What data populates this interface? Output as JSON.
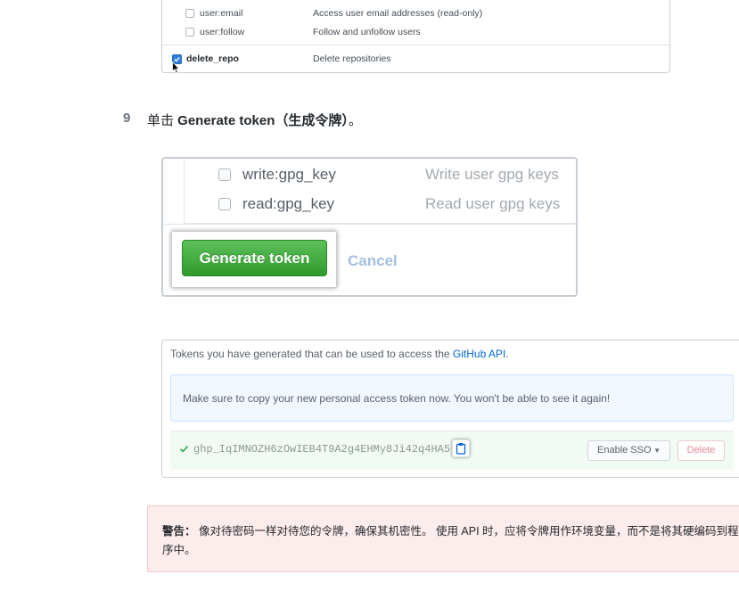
{
  "scopes": {
    "rows": [
      {
        "name": "user:email",
        "description": "Access user email addresses (read-only)",
        "checked": false
      },
      {
        "name": "user:follow",
        "description": "Follow and unfollow users",
        "checked": false
      }
    ],
    "delete_repo": {
      "name": "delete_repo",
      "description": "Delete repositories",
      "checked": true
    }
  },
  "step9": {
    "number": "9",
    "prefix": "单击 ",
    "button_ref": "Generate token（生成令牌）",
    "suffix": "。"
  },
  "generate_panel": {
    "gpg_rows": [
      {
        "name": "write:gpg_key",
        "description": "Write user gpg keys"
      },
      {
        "name": "read:gpg_key",
        "description": "Read user gpg keys"
      }
    ],
    "generate_label": "Generate token",
    "cancel_label": "Cancel"
  },
  "token_panel": {
    "intro_text": "Tokens you have generated that can be used to access the ",
    "intro_link": "GitHub API",
    "intro_end": ".",
    "notice": "Make sure to copy your new personal access token now. You won't be able to see it again!",
    "token": "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",
    "sso_label": "Enable SSO",
    "delete_label": "Delete"
  },
  "warning": {
    "label": "警告：",
    "text": " 像对待密码一样对待您的令牌，确保其机密性。 使用 API 时，应将令牌用作环境变量，而不是将其硬编码到程序中。"
  },
  "colors": {
    "generate_button": "#3aa837",
    "link": "#0366d6",
    "notice_bg": "#f1f8ff",
    "warning_bg": "#fdecec",
    "checkbox_checked": "#2f7fd9"
  }
}
